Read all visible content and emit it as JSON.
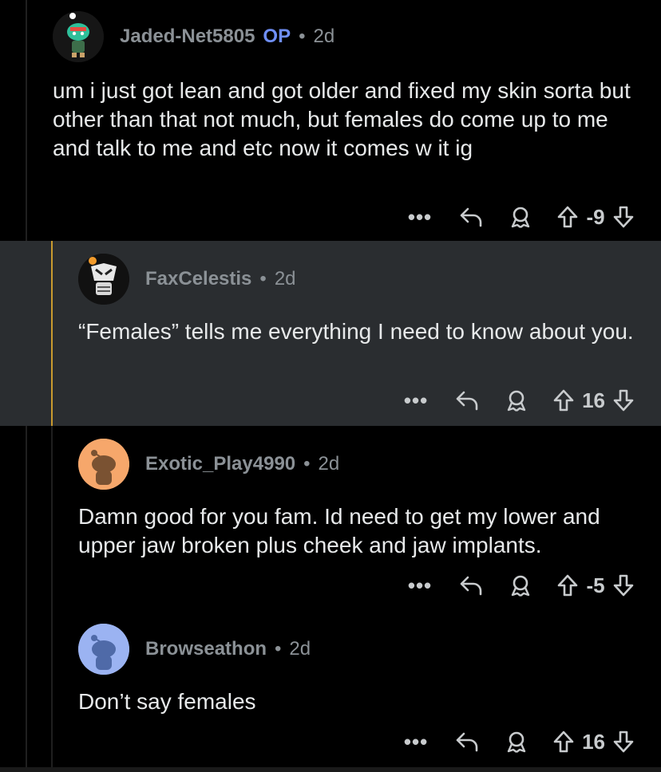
{
  "comments": [
    {
      "username": "Jaded-Net5805",
      "op_label": "OP",
      "separator": "•",
      "age": "2d",
      "text": "um i just got lean and got older and fixed my skin sorta but other than that not much, but females do come up to me and talk to me and etc now it comes w it ig",
      "more_label": "•••",
      "score": "-9",
      "avatar_color": "#1a1a1a"
    },
    {
      "username": "FaxCelestis",
      "separator": "•",
      "age": "2d",
      "text": "“Females” tells me everything I need to know about you.",
      "more_label": "•••",
      "score": "16",
      "avatar_color": "#1a1a1a",
      "highlight_bar_color": "#c99a2e"
    },
    {
      "username": "Exotic_Play4990",
      "separator": "•",
      "age": "2d",
      "text": "Damn good for you fam. Id need to get my lower and upper jaw broken plus cheek and jaw implants.",
      "more_label": "•••",
      "score": "-5",
      "avatar_color": "#f6a76b"
    },
    {
      "username": "Browseathon",
      "separator": "•",
      "age": "2d",
      "text": "Don’t say females",
      "more_label": "•••",
      "score": "16",
      "avatar_color": "#9bb3f2"
    }
  ],
  "icons": {
    "more": "more-icon",
    "reply": "reply-icon",
    "award": "award-icon",
    "upvote": "upvote-icon",
    "downvote": "downvote-icon"
  }
}
